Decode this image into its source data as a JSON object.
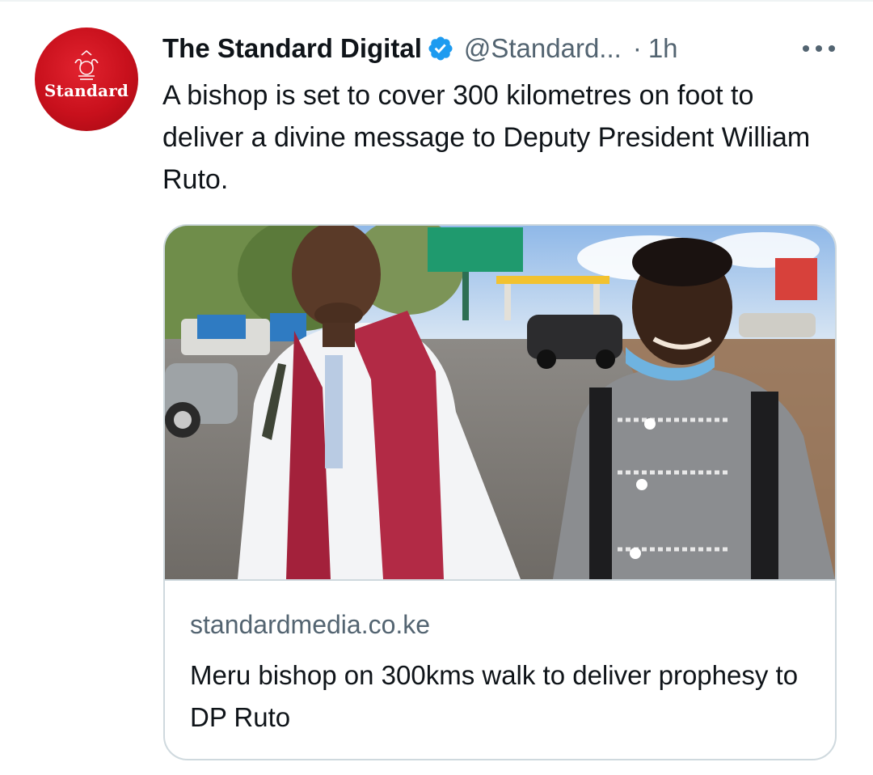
{
  "tweet": {
    "author": {
      "display_name": "The Standard Digital",
      "handle": "@Standard...",
      "verified": true,
      "avatar_text": "Standard",
      "avatar_color": "#c8101c"
    },
    "separator": "·",
    "time": "1h",
    "text": "A bishop is set to cover 300 kilometres on foot to deliver a divine message to Deputy President William Ruto.",
    "more_icon": "more-horizontal-icon",
    "verified_icon": "verified-badge-icon",
    "verified_color": "#1d9bf0"
  },
  "card": {
    "domain": "standardmedia.co.ke",
    "title": "Meru bishop on 300kms walk to deliver prophesy to DP Ruto"
  }
}
